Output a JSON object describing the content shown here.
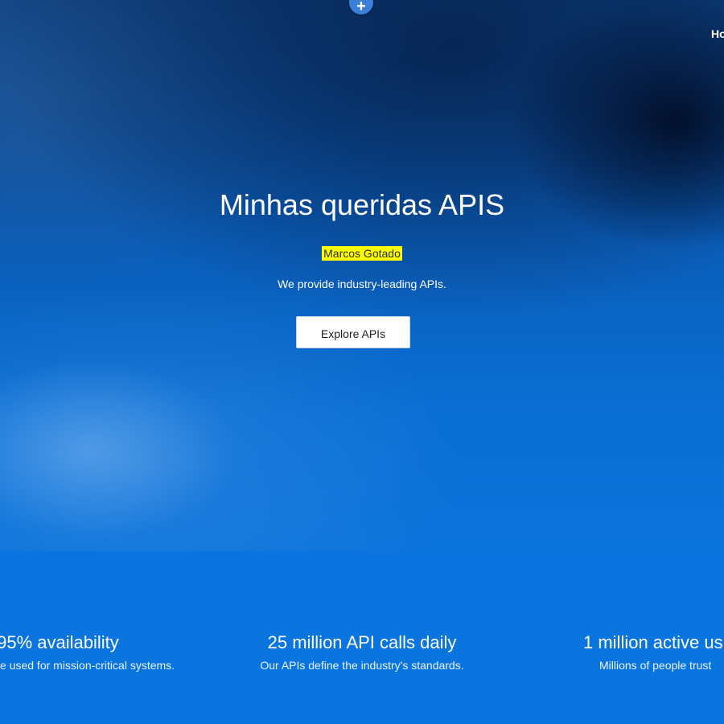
{
  "colors": {
    "author_highlight": "#ffff00",
    "stats_background": "#0a75de",
    "button_background": "#ffffff"
  },
  "header": {
    "add_icon": "plus-icon",
    "add_glyph": "+",
    "nav_home_label": "Ho"
  },
  "hero": {
    "title": "Minhas queridas APIS",
    "author": "Marcos Gotado",
    "tagline": "We provide industry-leading APIs.",
    "cta_label": "Explore APIs"
  },
  "stats": [
    {
      "title": ".95% availability",
      "description": "e used for mission-critical systems."
    },
    {
      "title": "25 million API calls daily",
      "description": "Our APIs define the industry's standards."
    },
    {
      "title": "1 million active us",
      "description": "Millions of people trust"
    }
  ]
}
